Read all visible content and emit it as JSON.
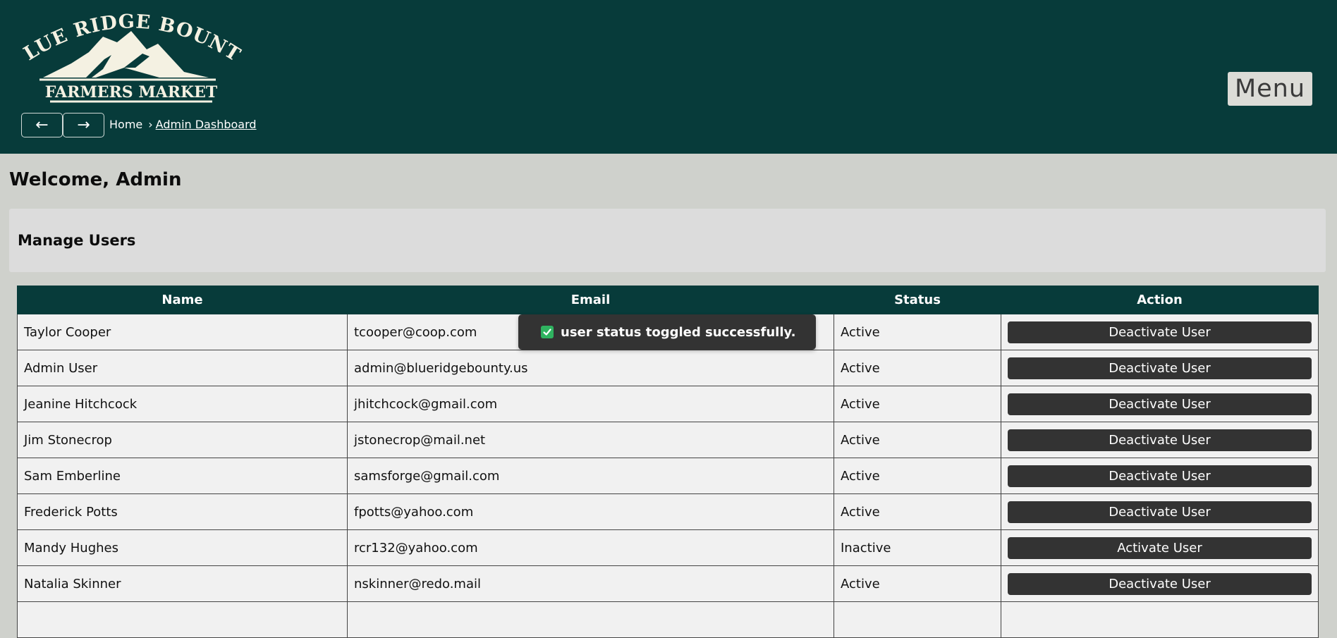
{
  "header": {
    "logo": {
      "line1": "BLUE RIDGE BOUNTY",
      "line2": "FARMERS MARKET"
    },
    "nav": {
      "back_label": "←",
      "forward_label": "→"
    },
    "breadcrumb": {
      "home": "Home",
      "separator": "›",
      "current": "Admin Dashboard"
    },
    "menu_label": "Menu"
  },
  "main": {
    "title": "Welcome, Admin",
    "panel_title": "Manage Users",
    "table": {
      "columns": [
        "Name",
        "Email",
        "Status",
        "Action"
      ],
      "rows": [
        {
          "name": "Taylor Cooper",
          "email": "tcooper@coop.com",
          "status": "Active",
          "action": "Deactivate User"
        },
        {
          "name": "Admin User",
          "email": "admin@blueridgebounty.us",
          "status": "Active",
          "action": "Deactivate User"
        },
        {
          "name": "Jeanine Hitchcock",
          "email": "jhitchcock@gmail.com",
          "status": "Active",
          "action": "Deactivate User"
        },
        {
          "name": "Jim Stonecrop",
          "email": "jstonecrop@mail.net",
          "status": "Active",
          "action": "Deactivate User"
        },
        {
          "name": "Sam Emberline",
          "email": "samsforge@gmail.com",
          "status": "Active",
          "action": "Deactivate User"
        },
        {
          "name": "Frederick Potts",
          "email": "fpotts@yahoo.com",
          "status": "Active",
          "action": "Deactivate User"
        },
        {
          "name": "Mandy Hughes",
          "email": "rcr132@yahoo.com",
          "status": "Inactive",
          "action": "Activate User"
        },
        {
          "name": "Natalia Skinner",
          "email": "nskinner@redo.mail",
          "status": "Active",
          "action": "Deactivate User"
        },
        {
          "name": "",
          "email": "",
          "status": "",
          "action": ""
        }
      ]
    }
  },
  "toast": {
    "icon": "check-square-icon",
    "message": "user status toggled successfully."
  },
  "colors": {
    "header_bg": "#073b3a",
    "page_bg": "#cfd1cc",
    "button_bg": "#333333",
    "toast_check": "#2fb360"
  }
}
